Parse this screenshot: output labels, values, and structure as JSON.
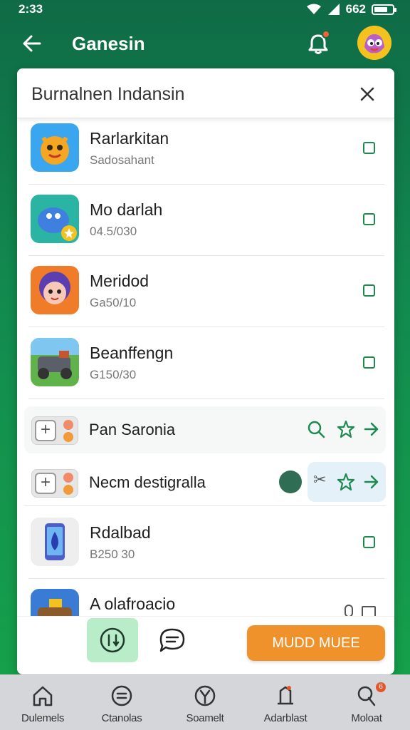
{
  "status_bar": {
    "time": "2:33",
    "battery": "662"
  },
  "app_bar": {
    "title": "Ganesin"
  },
  "sheet": {
    "title": "Burnalnen Indansin",
    "items": [
      {
        "title": "Rarlarkitan",
        "subtitle": "Sadosahant"
      },
      {
        "title": "Mo darlah",
        "subtitle": "04.5/030"
      },
      {
        "title": "Meridod",
        "subtitle": "Ga50/10"
      },
      {
        "title": "Beanffengn",
        "subtitle": "G150/30"
      }
    ],
    "toggle_rows": [
      {
        "label": "Pan Saronia"
      },
      {
        "label": "Necm destigralla"
      }
    ],
    "items2": [
      {
        "title": "Rdalbad",
        "subtitle": "B250 30"
      },
      {
        "title": "A olafroacio",
        "subtitle": ""
      }
    ]
  },
  "action_bar": {
    "primary_label": "MUDD MUEE"
  },
  "bottom_nav": [
    {
      "label": "Dulemels",
      "icon": "home-icon"
    },
    {
      "label": "Ctanolas",
      "icon": "equal-circle-icon"
    },
    {
      "label": "Soamelt",
      "icon": "y-circle-icon"
    },
    {
      "label": "Adarblast",
      "icon": "tag-icon",
      "badge": ""
    },
    {
      "label": "Moloat",
      "icon": "pin-icon",
      "badge": "6"
    }
  ],
  "colors": {
    "brand_green": "#128a4f",
    "accent_orange": "#f0922b"
  }
}
